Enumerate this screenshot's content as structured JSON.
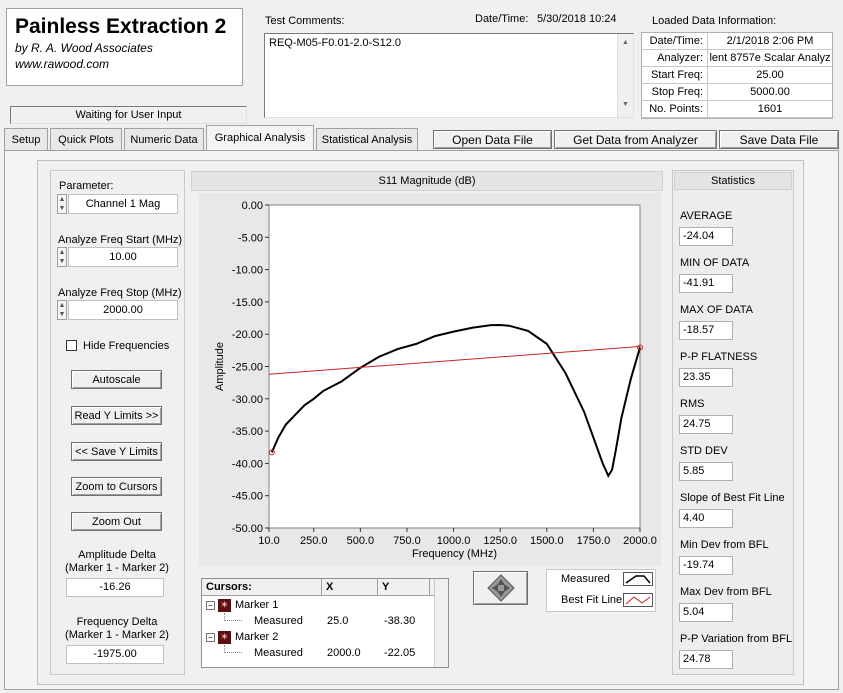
{
  "header": {
    "app_title": "Painless Extraction 2",
    "company": "by R. A. Wood Associates",
    "website": "www.rawood.com",
    "status": "Waiting for User Input"
  },
  "comments": {
    "label": "Test Comments:",
    "datetime_label": "Date/Time:",
    "datetime_value": "5/30/2018  10:24",
    "text": "REQ-M05-F0.01-2.0-S12.0"
  },
  "loaded": {
    "title": "Loaded Data Information:",
    "rows": [
      {
        "k": "Date/Time:",
        "v": "2/1/2018 2:06 PM"
      },
      {
        "k": "Analyzer:",
        "v": "lent 8757e Scalar Analyz"
      },
      {
        "k": "Start Freq:",
        "v": "25.00"
      },
      {
        "k": "Stop Freq:",
        "v": "5000.00"
      },
      {
        "k": "No. Points:",
        "v": "1601"
      }
    ]
  },
  "tabs": [
    "Setup",
    "Quick Plots",
    "Numeric Data",
    "Graphical Analysis",
    "Statistical Analysis"
  ],
  "actions": {
    "open": "Open Data File",
    "get": "Get Data from Analyzer",
    "save": "Save Data File"
  },
  "left": {
    "param_label": "Parameter:",
    "param_value": "Channel 1 Mag",
    "start_label": "Analyze Freq Start (MHz)",
    "start_value": "10.00",
    "stop_label": "Analyze Freq Stop (MHz)",
    "stop_value": "2000.00",
    "hide_freq": "Hide Frequencies",
    "autoscale": "Autoscale",
    "read_y": "Read Y Limits >>",
    "save_y": "<< Save Y Limits",
    "zoom_cursors": "Zoom to Cursors",
    "zoom_out": "Zoom Out",
    "amp_delta_label1": "Amplitude Delta",
    "amp_delta_label2": "(Marker 1 - Marker 2)",
    "amp_delta_value": "-16.26",
    "freq_delta_label1": "Frequency Delta",
    "freq_delta_label2": "(Marker 1 - Marker 2)",
    "freq_delta_value": "-1975.00"
  },
  "chart_data": {
    "type": "line",
    "title": "S11 Magnitude (dB)",
    "xlabel": "Frequency (MHz)",
    "ylabel": "Amplitude",
    "xlim": [
      10,
      2000
    ],
    "ylim": [
      -50,
      0
    ],
    "xticks": [
      "10.0",
      "250.0",
      "500.0",
      "750.0",
      "1000.0",
      "1250.0",
      "1500.0",
      "1750.0",
      "2000.0"
    ],
    "xtick_values": [
      10,
      250,
      500,
      750,
      1000,
      1250,
      1500,
      1750,
      2000
    ],
    "yticks": [
      "0.00",
      "-5.00",
      "-10.00",
      "-15.00",
      "-20.00",
      "-25.00",
      "-30.00",
      "-35.00",
      "-40.00",
      "-45.00",
      "-50.00"
    ],
    "ytick_values": [
      0,
      -5,
      -10,
      -15,
      -20,
      -25,
      -30,
      -35,
      -40,
      -45,
      -50
    ],
    "series": [
      {
        "name": "Measured",
        "color": "#000000",
        "x": [
          25,
          60,
          100,
          150,
          200,
          250,
          300,
          400,
          500,
          600,
          700,
          800,
          900,
          1000,
          1100,
          1200,
          1250,
          1300,
          1400,
          1500,
          1600,
          1700,
          1750,
          1800,
          1830,
          1850,
          1870,
          1900,
          1950,
          2000
        ],
        "y": [
          -38.3,
          -36,
          -34,
          -32.5,
          -31,
          -30,
          -28.8,
          -27.3,
          -25.2,
          -23.5,
          -22.3,
          -21.5,
          -20.3,
          -19.6,
          -19,
          -18.6,
          -18.57,
          -18.7,
          -19.5,
          -21.5,
          -26,
          -32,
          -36,
          -40,
          -41.91,
          -41,
          -38,
          -33,
          -27,
          -22.05
        ]
      },
      {
        "name": "Best Fit Line",
        "color": "#cc2222",
        "x": [
          10,
          2000
        ],
        "y": [
          -26.2,
          -21.9
        ]
      }
    ]
  },
  "legend": {
    "measured": "Measured",
    "bestfit": "Best Fit Line"
  },
  "cursors": {
    "headers": [
      "Cursors:",
      "X",
      "Y"
    ],
    "rows": [
      {
        "name": "Marker 1",
        "sub": "Measured",
        "x": "25.0",
        "y": "-38.30"
      },
      {
        "name": "Marker 2",
        "sub": "Measured",
        "x": "2000.0",
        "y": "-22.05"
      }
    ]
  },
  "stats": {
    "title": "Statistics",
    "items": [
      {
        "label": "AVERAGE",
        "value": "-24.04"
      },
      {
        "label": "MIN OF DATA",
        "value": "-41.91"
      },
      {
        "label": "MAX OF DATA",
        "value": "-18.57"
      },
      {
        "label": "P-P FLATNESS",
        "value": "23.35"
      },
      {
        "label": "RMS",
        "value": "24.75"
      },
      {
        "label": "STD DEV",
        "value": "5.85"
      },
      {
        "label": "Slope of Best Fit Line",
        "value": "4.40"
      },
      {
        "label": "Min Dev from BFL",
        "value": "-19.74"
      },
      {
        "label": "Max Dev from BFL",
        "value": "5.04"
      },
      {
        "label": "P-P Variation from BFL",
        "value": "24.78"
      }
    ]
  }
}
